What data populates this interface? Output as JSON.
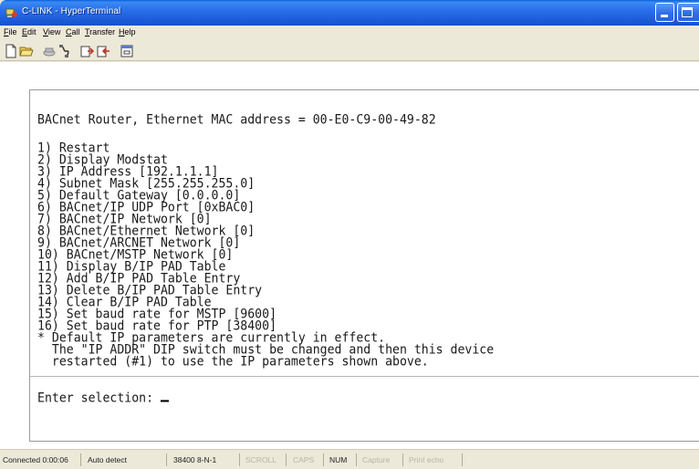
{
  "window": {
    "title": "C-LINK - HyperTerminal"
  },
  "menu": [
    {
      "label": "File",
      "key": "F",
      "rest": "ile"
    },
    {
      "label": "Edit",
      "key": "E",
      "rest": "dit"
    },
    {
      "label": "View",
      "key": "V",
      "rest": "iew"
    },
    {
      "label": "Call",
      "key": "C",
      "rest": "all"
    },
    {
      "label": "Transfer",
      "key": "T",
      "rest": "ransfer"
    },
    {
      "label": "Help",
      "key": "H",
      "rest": "elp"
    }
  ],
  "toolbar": {
    "icons": [
      "new-icon",
      "open-icon",
      "connect-icon",
      "disconnect-icon",
      "send-icon",
      "receive-icon",
      "properties-icon"
    ]
  },
  "terminal": {
    "header": "BACnet Router, Ethernet MAC address = 00-E0-C9-00-49-82",
    "menu_lines": [
      "1) Restart",
      "2) Display Modstat",
      "3) IP Address [192.1.1.1]",
      "4) Subnet Mask [255.255.255.0]",
      "5) Default Gateway [0.0.0.0]",
      "6) BACnet/IP UDP Port [0xBAC0]",
      "7) BACnet/IP Network [0]",
      "8) BACnet/Ethernet Network [0]",
      "9) BACnet/ARCNET Network [0]",
      "10) BACnet/MSTP Network [0]",
      "11) Display B/IP PAD Table",
      "12) Add B/IP PAD Table Entry",
      "13) Delete B/IP PAD Table Entry",
      "14) Clear B/IP PAD Table",
      "15) Set baud rate for MSTP [9600]",
      "16) Set baud rate for PTP [38400]",
      "* Default IP parameters are currently in effect.",
      "  The \"IP ADDR\" DIP switch must be changed and then this device",
      "  restarted (#1) to use the IP parameters shown above."
    ],
    "prompt": "Enter selection: "
  },
  "status": [
    {
      "label": "Connected 0:00:06",
      "active": true
    },
    {
      "label": "Auto detect",
      "active": true
    },
    {
      "label": "38400 8-N-1",
      "active": true
    },
    {
      "label": "SCROLL",
      "active": false
    },
    {
      "label": "CAPS",
      "active": false
    },
    {
      "label": "NUM",
      "active": true
    },
    {
      "label": "Capture",
      "active": false
    },
    {
      "label": "Print echo",
      "active": false
    }
  ]
}
